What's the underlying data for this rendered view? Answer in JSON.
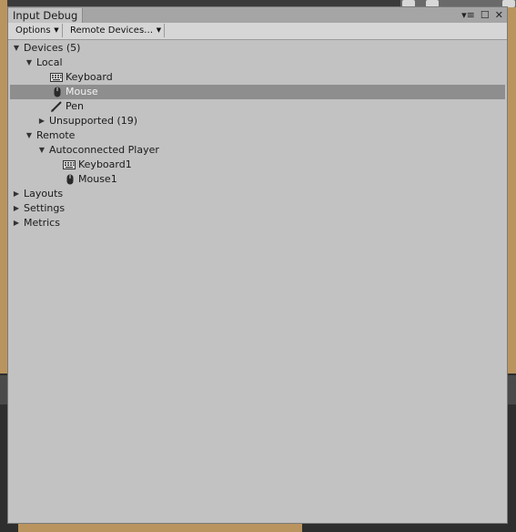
{
  "window": {
    "tab_title": "Input Debug",
    "controls": {
      "menu": "▾≡",
      "maximize": "☐",
      "close": "✕"
    }
  },
  "toolbar": {
    "options_label": "Options",
    "remote_devices_label": "Remote Devices…"
  },
  "tree": {
    "devices": {
      "label": "Devices (5)",
      "expanded": true
    },
    "local": {
      "label": "Local",
      "expanded": true
    },
    "keyboard": {
      "label": "Keyboard",
      "icon": "keyboard-icon"
    },
    "mouse": {
      "label": "Mouse",
      "icon": "mouse-icon",
      "selected": true
    },
    "pen": {
      "label": "Pen",
      "icon": "pen-icon"
    },
    "unsupported": {
      "label": "Unsupported (19)",
      "expanded": false
    },
    "remote": {
      "label": "Remote",
      "expanded": true
    },
    "autoconnected_player": {
      "label": "Autoconnected Player",
      "expanded": true
    },
    "keyboard1": {
      "label": "Keyboard1",
      "icon": "keyboard-icon"
    },
    "mouse1": {
      "label": "Mouse1",
      "icon": "mouse-icon"
    },
    "layouts": {
      "label": "Layouts",
      "expanded": false
    },
    "settings": {
      "label": "Settings",
      "expanded": false
    },
    "metrics": {
      "label": "Metrics",
      "expanded": false
    }
  },
  "colors": {
    "window_bg": "#c2c2c2",
    "selection": "#8e8e8e",
    "backdrop_tan": "#b9945f",
    "backdrop_dark": "#2e2e2e"
  }
}
